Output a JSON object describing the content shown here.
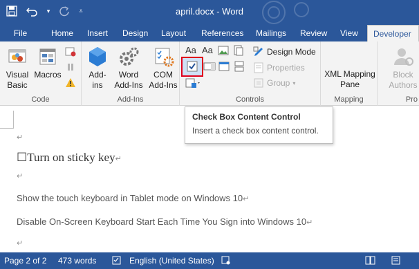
{
  "window": {
    "title": "april.docx - Word"
  },
  "qat": {
    "save": "save-icon",
    "undo": "undo-icon",
    "redo": "redo-icon",
    "customize": "customize-icon"
  },
  "tabs": [
    {
      "label": "File"
    },
    {
      "label": "Home"
    },
    {
      "label": "Insert"
    },
    {
      "label": "Design"
    },
    {
      "label": "Layout"
    },
    {
      "label": "References"
    },
    {
      "label": "Mailings"
    },
    {
      "label": "Review"
    },
    {
      "label": "View"
    },
    {
      "label": "Developer",
      "active": true
    }
  ],
  "ribbon": {
    "code": {
      "label": "Code",
      "visual_basic": [
        "Visual",
        "Basic"
      ],
      "macros": "Macros"
    },
    "addins": {
      "label": "Add-Ins",
      "addins_btn": [
        "Add-",
        "ins"
      ],
      "word_addins": [
        "Word",
        "Add-Ins"
      ],
      "com_addins": [
        "COM",
        "Add-Ins"
      ]
    },
    "controls": {
      "label": "Controls",
      "design_mode": "Design Mode",
      "properties": "Properties",
      "group": "Group",
      "aa1": "Aa",
      "aa2": "Aa"
    },
    "mapping": {
      "label": "Mapping",
      "xml_pane": [
        "XML Mapping",
        "Pane"
      ]
    },
    "protect": {
      "label": "Pro",
      "block_authors": [
        "Block",
        "Authors"
      ]
    }
  },
  "tooltip": {
    "title": "Check Box Content Control",
    "body": "Insert a check box content control."
  },
  "document": {
    "para_mark": "↵",
    "checkbox_line": "☐Turn on sticky key",
    "line1": "Show the touch keyboard in Tablet mode on Windows 10",
    "line2": "Disable On-Screen Keyboard Start Each Time You Sign into Windows 10"
  },
  "status": {
    "page": "Page 2 of 2",
    "words": "473 words",
    "language": "English (United States)"
  },
  "colors": {
    "accent": "#2b579a",
    "highlight": "#e0001b"
  }
}
